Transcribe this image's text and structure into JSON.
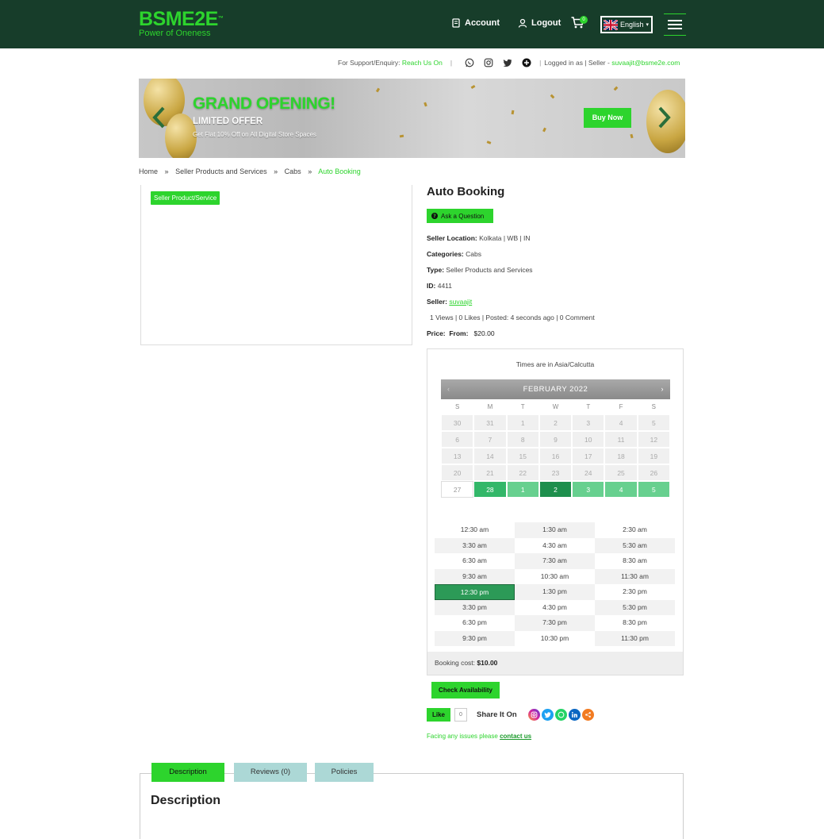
{
  "header": {
    "logo": "BSME2E",
    "logo_tm": "™",
    "tagline": "Power of Oneness",
    "account_label": "Account",
    "logout_label": "Logout",
    "cart_count": "0",
    "language": "English",
    "language_caret": "▾"
  },
  "support": {
    "label": "For Support/Enquiry:",
    "link": "Reach Us On",
    "logged_in_label": "Logged in as | Seller -",
    "email": "suvaajit@bsme2e.com"
  },
  "banner": {
    "title": "GRAND OPENING!",
    "subtitle": "LIMITED OFFER",
    "small": "Get Flat 10% Off on All Digital Store Spaces",
    "button": "Buy Now"
  },
  "breadcrumb": {
    "items": [
      "Home",
      "Seller Products and Services",
      "Cabs",
      "Auto Booking"
    ],
    "separator": "»"
  },
  "product": {
    "tag": "Seller Product/Service",
    "title": "Auto Booking",
    "ask_button": "Ask a Question",
    "location_label": "Seller Location:",
    "location_value": "Kolkata | WB | IN",
    "categories_label": "Categories:",
    "categories_value": "Cabs",
    "type_label": "Type:",
    "type_value": "Seller Products and Services",
    "id_label": "ID:",
    "id_value": "4411",
    "seller_label": "Seller:",
    "seller_value": "suvaajit",
    "stats": "1 Views | 0 Likes | Posted: 4 seconds ago | 0 Comment",
    "price_label": "Price:",
    "price_from": "From:",
    "price_value": "$20.00"
  },
  "booking": {
    "timezone": "Times are in Asia/Calcutta",
    "month": "FEBRUARY 2022",
    "prev": "‹",
    "next": "›",
    "weekdays": [
      "S",
      "M",
      "T",
      "W",
      "T",
      "F",
      "S"
    ],
    "days": [
      [
        "30",
        "31",
        "1",
        "2",
        "3",
        "4",
        "5"
      ],
      [
        "6",
        "7",
        "8",
        "9",
        "10",
        "11",
        "12"
      ],
      [
        "13",
        "14",
        "15",
        "16",
        "17",
        "18",
        "19"
      ],
      [
        "20",
        "21",
        "22",
        "23",
        "24",
        "25",
        "26"
      ],
      [
        "27",
        "28",
        "1",
        "2",
        "3",
        "4",
        "5"
      ]
    ],
    "slots": [
      "12:30 am",
      "1:30 am",
      "2:30 am",
      "3:30 am",
      "4:30 am",
      "5:30 am",
      "6:30 am",
      "7:30 am",
      "8:30 am",
      "9:30 am",
      "10:30 am",
      "11:30 am",
      "12:30 pm",
      "1:30 pm",
      "2:30 pm",
      "3:30 pm",
      "4:30 pm",
      "5:30 pm",
      "6:30 pm",
      "7:30 pm",
      "8:30 pm",
      "9:30 pm",
      "10:30 pm",
      "11:30 pm"
    ],
    "selected_slot": "12:30 pm",
    "cost_label": "Booking cost:",
    "cost_value": "$10.00",
    "check_button": "Check Availability"
  },
  "social": {
    "like": "Like",
    "like_count": "0",
    "share_label": "Share It On",
    "issue_text": "Facing any issues please",
    "contact": "contact us"
  },
  "tabs": [
    "Description",
    "Reviews (0)",
    "Policies"
  ],
  "description_title": "Description",
  "colors": {
    "header_bg": "#173d2a",
    "brand_green": "#2dd42d",
    "selected_day": "#1e8f4d",
    "available_day": "#67d08f"
  }
}
